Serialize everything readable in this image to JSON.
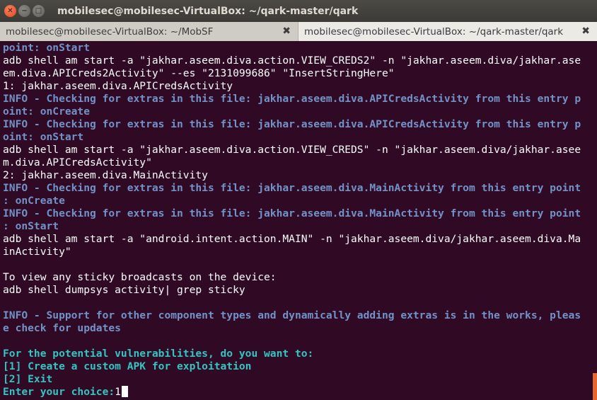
{
  "window": {
    "title": "mobilesec@mobilesec-VirtualBox: ~/qark-master/qark",
    "buttons": {
      "close": "✕",
      "minimize": "−",
      "maximize": "□"
    }
  },
  "tabs": [
    {
      "label": "mobilesec@mobilesec-VirtualBox: ~/MobSF",
      "close": "✖"
    },
    {
      "label": "mobilesec@mobilesec-VirtualBox: ~/qark-master/qark",
      "close": "✖"
    }
  ],
  "colors": {
    "background": "#300a24",
    "info_text": "#7292c8",
    "prompt_text": "#34c5c2",
    "plain_text": "#ffffff",
    "scroll_thumb": "#e3672e"
  },
  "terminal_lines": [
    {
      "style": "info",
      "text": "point: onStart"
    },
    {
      "style": "plain",
      "text": "adb shell am start -a \"jakhar.aseem.diva.action.VIEW_CREDS2\" -n \"jakhar.aseem.diva/jakhar.ase"
    },
    {
      "style": "plain",
      "text": "em.diva.APICreds2Activity\" --es \"2131099686\" \"InsertStringHere\""
    },
    {
      "style": "plain",
      "text": "1: jakhar.aseem.diva.APICredsActivity"
    },
    {
      "style": "info",
      "text": "INFO - Checking for extras in this file: jakhar.aseem.diva.APICredsActivity from this entry p"
    },
    {
      "style": "info",
      "text": "oint: onCreate"
    },
    {
      "style": "info",
      "text": "INFO - Checking for extras in this file: jakhar.aseem.diva.APICredsActivity from this entry p"
    },
    {
      "style": "info",
      "text": "oint: onStart"
    },
    {
      "style": "plain",
      "text": "adb shell am start -a \"jakhar.aseem.diva.action.VIEW_CREDS\" -n \"jakhar.aseem.diva/jakhar.asee"
    },
    {
      "style": "plain",
      "text": "m.diva.APICredsActivity\""
    },
    {
      "style": "plain",
      "text": "2: jakhar.aseem.diva.MainActivity"
    },
    {
      "style": "info",
      "text": "INFO - Checking for extras in this file: jakhar.aseem.diva.MainActivity from this entry point"
    },
    {
      "style": "info",
      "text": ": onCreate"
    },
    {
      "style": "info",
      "text": "INFO - Checking for extras in this file: jakhar.aseem.diva.MainActivity from this entry point"
    },
    {
      "style": "info",
      "text": ": onStart"
    },
    {
      "style": "plain",
      "text": "adb shell am start -a \"android.intent.action.MAIN\" -n \"jakhar.aseem.diva/jakhar.aseem.diva.Ma"
    },
    {
      "style": "plain",
      "text": "inActivity\""
    },
    {
      "style": "plain",
      "text": ""
    },
    {
      "style": "plain",
      "text": "To view any sticky broadcasts on the device:"
    },
    {
      "style": "plain",
      "text": "adb shell dumpsys activity| grep sticky"
    },
    {
      "style": "plain",
      "text": ""
    },
    {
      "style": "info",
      "text": "INFO - Support for other component types and dynamically adding extras is in the works, pleas"
    },
    {
      "style": "info",
      "text": "e check for updates"
    },
    {
      "style": "plain",
      "text": ""
    },
    {
      "style": "prompt",
      "text": "For the potential vulnerabilities, do you want to:"
    },
    {
      "style": "prompt",
      "text": "[1] Create a custom APK for exploitation"
    },
    {
      "style": "prompt",
      "text": "[2] Exit"
    }
  ],
  "input_prompt": {
    "label": "Enter your choice:",
    "value": "1"
  }
}
